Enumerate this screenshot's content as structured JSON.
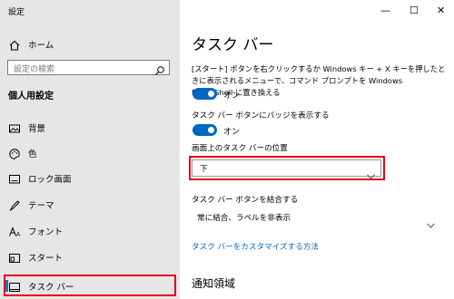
{
  "window": {
    "title": "設定",
    "minimize": "—",
    "maximize": "☐",
    "close": "✕"
  },
  "sidebar": {
    "home": "ホーム",
    "search_placeholder": "設定の検索",
    "section_title": "個人用設定",
    "items": [
      {
        "label": "背景",
        "icon": "image-icon"
      },
      {
        "label": "色",
        "icon": "palette-icon"
      },
      {
        "label": "ロック画面",
        "icon": "lock-screen-icon"
      },
      {
        "label": "テーマ",
        "icon": "theme-brush-icon"
      },
      {
        "label": "フォント",
        "icon": "font-icon"
      },
      {
        "label": "スタート",
        "icon": "start-icon"
      },
      {
        "label": "タスク バー",
        "icon": "taskbar-icon",
        "selected": true
      }
    ]
  },
  "main": {
    "title": "タスク バー",
    "start_replace_text": "[スタート] ボタンを右クリックするか Windows キー + X キーを押したときに表示されるメニューで、コマンド プロンプトを Windows PowerShell に置き換える",
    "toggle1_state": "オン",
    "badge_label": "タスク バー ボタンにバッジを表示する",
    "toggle2_state": "オン",
    "position_label": "画面上のタスク バーの位置",
    "position_value": "下",
    "combine_label": "タスク バー ボタンを結合する",
    "combine_value": "常に結合、ラベルを非表示",
    "customize_link": "タスク バーをカスタマイズする方法",
    "notification_heading": "通知領域"
  },
  "colors": {
    "accent": "#0067c0",
    "highlight_red": "#e60012",
    "sidebar_bg": "#e6e6e6",
    "link": "#0066cc"
  }
}
